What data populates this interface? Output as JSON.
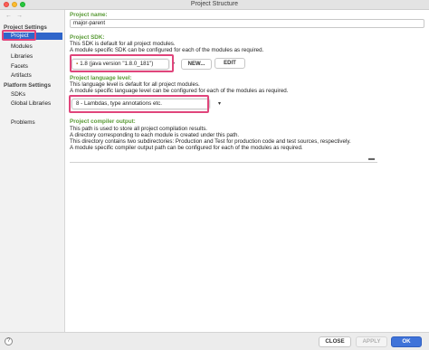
{
  "window": {
    "title": "Project Structure"
  },
  "nav": {
    "back": "←",
    "forward": "→"
  },
  "sidebar": {
    "project_settings_header": "Project Settings",
    "project_settings_items": [
      "Project",
      "Modules",
      "Libraries",
      "Facets",
      "Artifacts"
    ],
    "platform_settings_header": "Platform Settings",
    "platform_settings_items": [
      "SDKs",
      "Global Libraries"
    ],
    "problems": "Problems",
    "selected": "Project"
  },
  "main": {
    "project_name": {
      "label": "Project name:",
      "value": "major-parent"
    },
    "project_sdk": {
      "label": "Project SDK:",
      "desc1": "This SDK is default for all project modules.",
      "desc2": "A module specific SDK can be configured for each of the modules as required.",
      "value": "1.8 (java version \"1.8.0_181\")",
      "new_button": "NEW...",
      "edit_button": "EDIT"
    },
    "language_level": {
      "label": "Project language level:",
      "desc1": "This language level is default for all project modules.",
      "desc2": "A module specific language level can be configured for each of the modules as required.",
      "value": "8 - Lambdas, type annotations etc."
    },
    "compiler_output": {
      "label": "Project compiler output:",
      "desc1": "This path is used to store all project compilation results.",
      "desc2": "A directory corresponding to each module is created under this path.",
      "desc3": "This directory contains two subdirectories: Production and Test for production code and test sources, respectively.",
      "desc4": "A module specific compiler output path can be configured for each of the modules as required.",
      "value": ""
    }
  },
  "footer": {
    "help": "?",
    "close": "CLOSE",
    "apply": "APPLY",
    "ok": "OK"
  },
  "colors": {
    "accent": "#2f65ca",
    "label_green": "#5a9b37",
    "highlight": "#e0457b",
    "ok_button": "#3f73d9"
  },
  "icons": {
    "folder": "folder-icon",
    "dropdown": "chevron-down-icon",
    "help": "help-icon"
  }
}
